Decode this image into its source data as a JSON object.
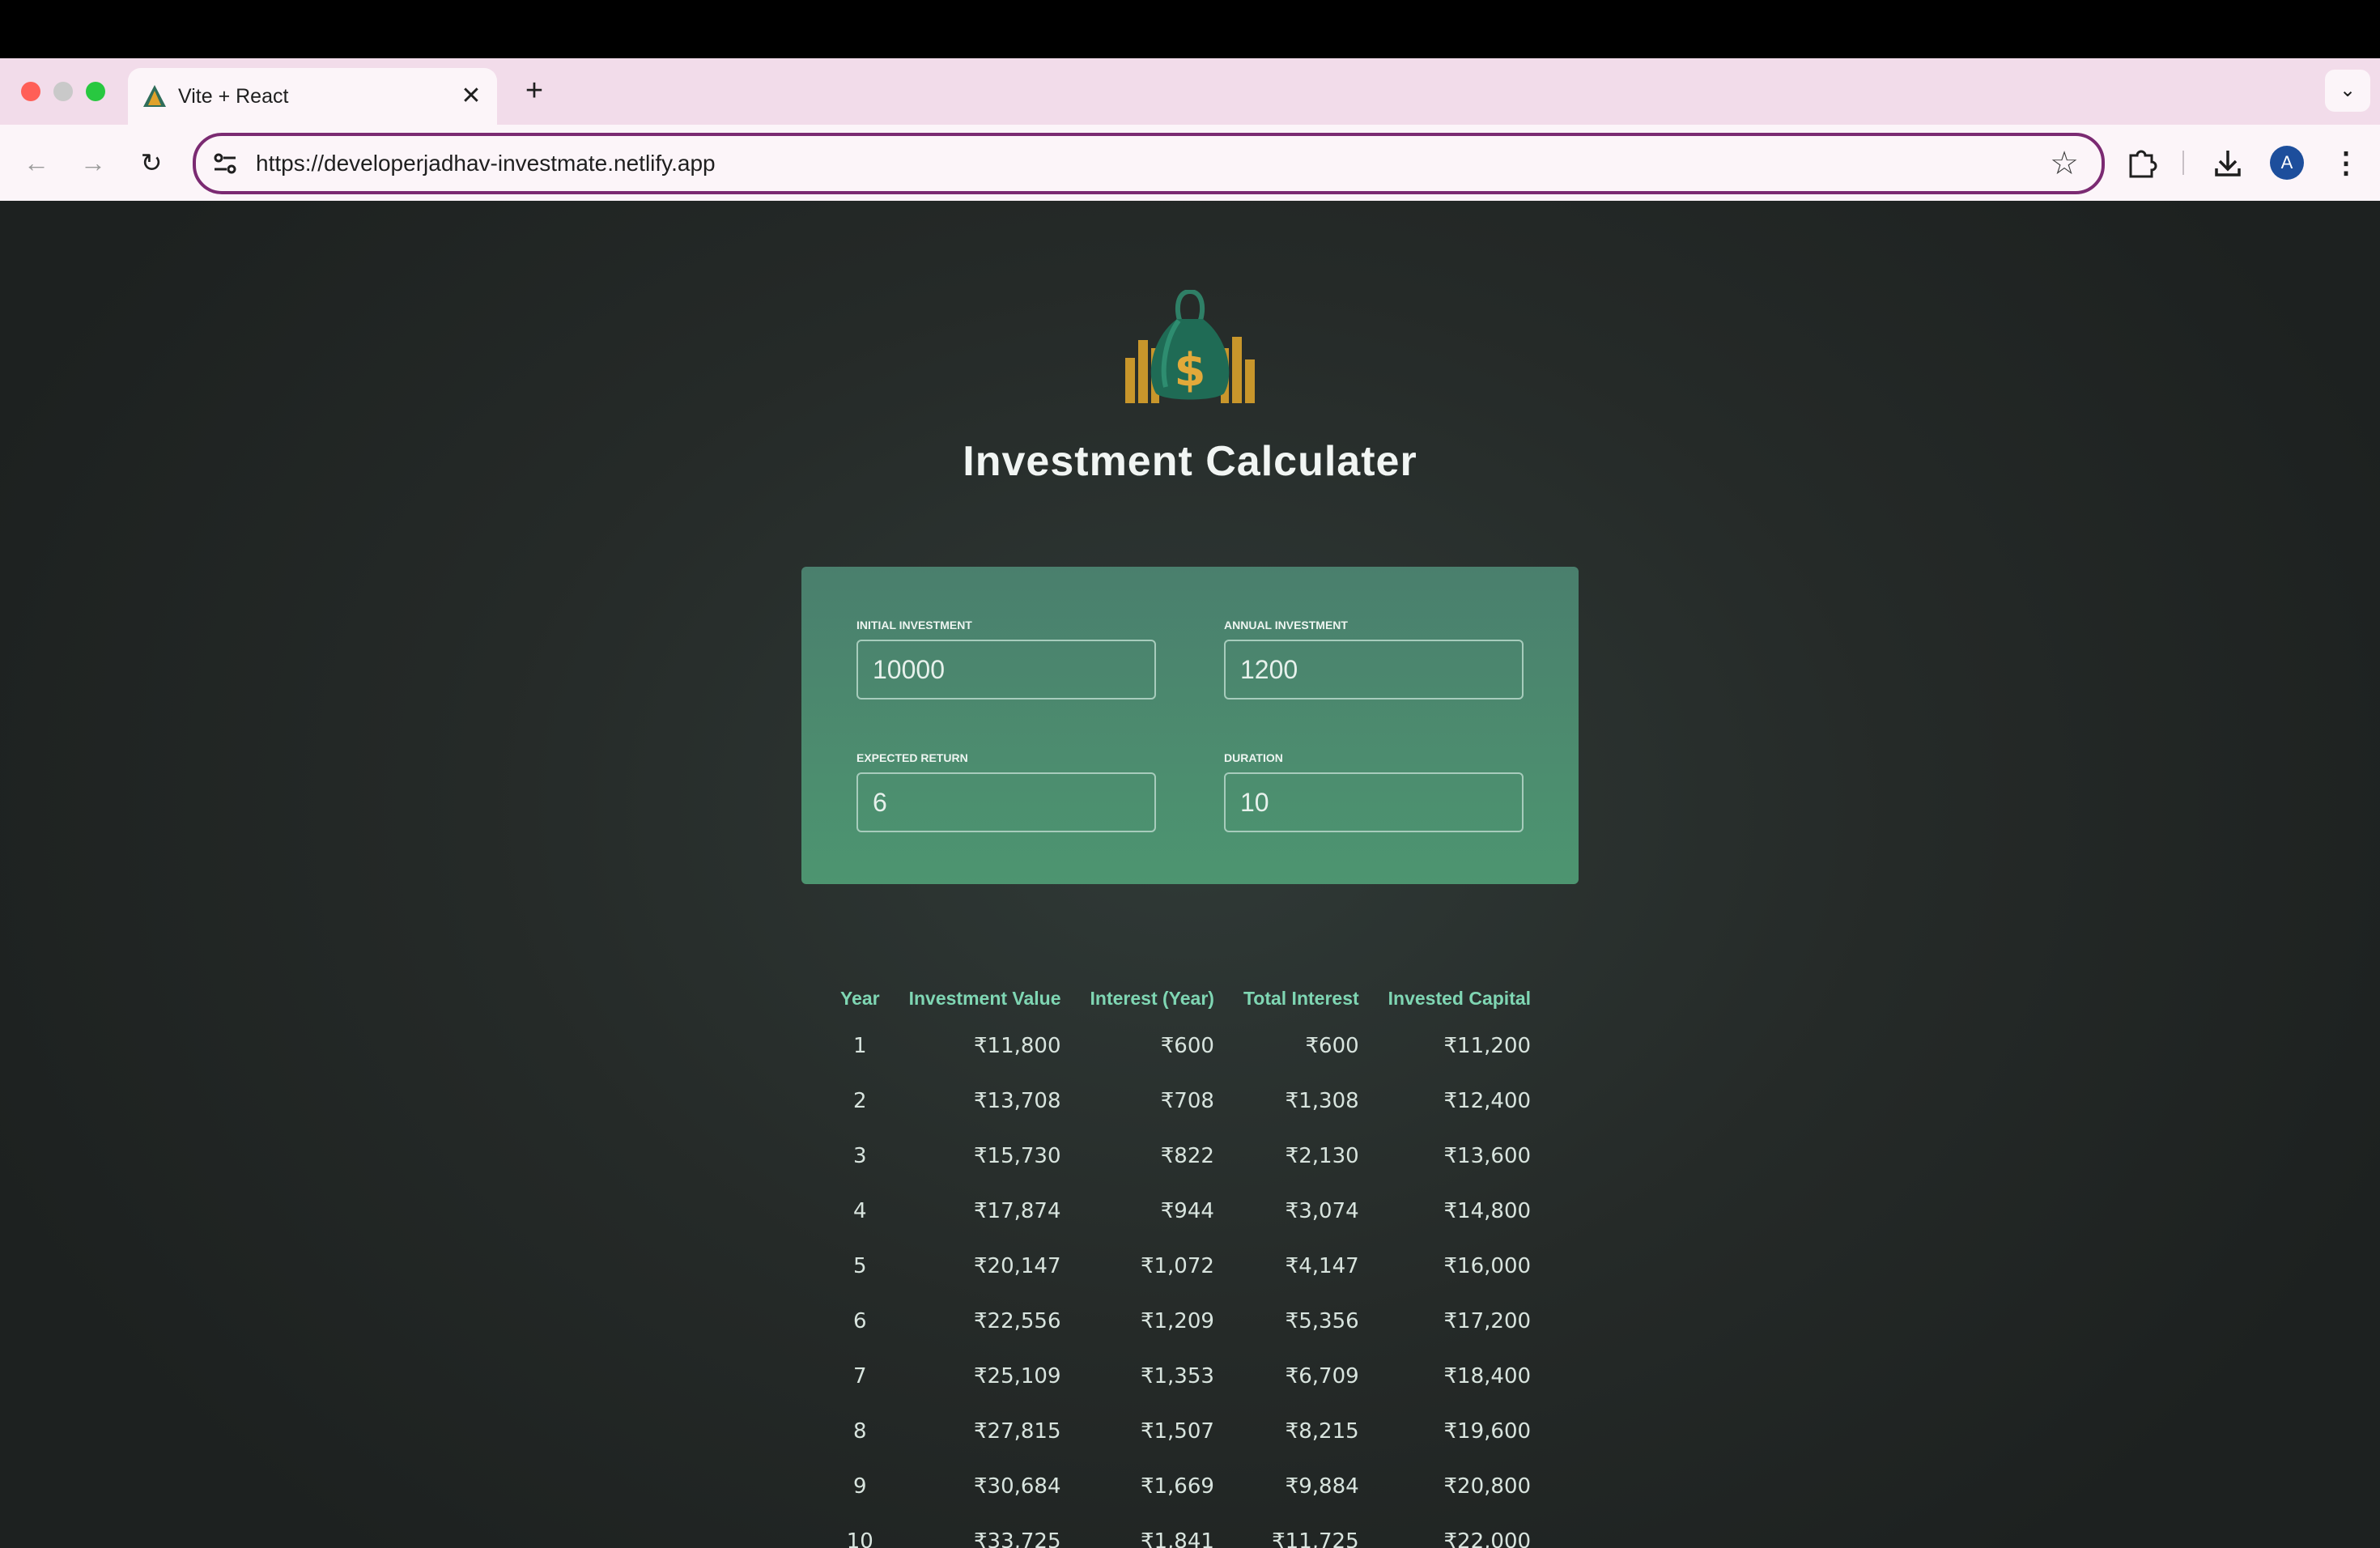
{
  "browser": {
    "tab_title": "Vite + React",
    "tab_close": "✕",
    "new_tab": "+",
    "tab_search": "⌄",
    "url": "https://developerjadhav-investmate.netlify.app",
    "back": "←",
    "forward": "→",
    "reload": "↻",
    "bookmark": "☆",
    "profile_initial": "A",
    "menu": "⋮",
    "colors": {
      "close": "#ff5f57",
      "minimize": "#c9c9c9",
      "zoom": "#28c840",
      "accent": "#7b2a72"
    }
  },
  "app": {
    "title": "Investment Calculater",
    "logo_icon": "money-bag-icon"
  },
  "inputs": {
    "initial_investment": {
      "label": "Initial Investment",
      "value": "10000"
    },
    "annual_investment": {
      "label": "Annual Investment",
      "value": "1200"
    },
    "expected_return": {
      "label": "Expected Return",
      "value": "6"
    },
    "duration": {
      "label": "Duration",
      "value": "10"
    }
  },
  "results": {
    "headers": [
      "Year",
      "Investment Value",
      "Interest (Year)",
      "Total Interest",
      "Invested Capital"
    ],
    "rows": [
      [
        "1",
        "₹11,800",
        "₹600",
        "₹600",
        "₹11,200"
      ],
      [
        "2",
        "₹13,708",
        "₹708",
        "₹1,308",
        "₹12,400"
      ],
      [
        "3",
        "₹15,730",
        "₹822",
        "₹2,130",
        "₹13,600"
      ],
      [
        "4",
        "₹17,874",
        "₹944",
        "₹3,074",
        "₹14,800"
      ],
      [
        "5",
        "₹20,147",
        "₹1,072",
        "₹4,147",
        "₹16,000"
      ],
      [
        "6",
        "₹22,556",
        "₹1,209",
        "₹5,356",
        "₹17,200"
      ],
      [
        "7",
        "₹25,109",
        "₹1,353",
        "₹6,709",
        "₹18,400"
      ],
      [
        "8",
        "₹27,815",
        "₹1,507",
        "₹8,215",
        "₹19,600"
      ],
      [
        "9",
        "₹30,684",
        "₹1,669",
        "₹9,884",
        "₹20,800"
      ],
      [
        "10",
        "₹33,725",
        "₹1,841",
        "₹11,725",
        "₹22,000"
      ]
    ]
  }
}
